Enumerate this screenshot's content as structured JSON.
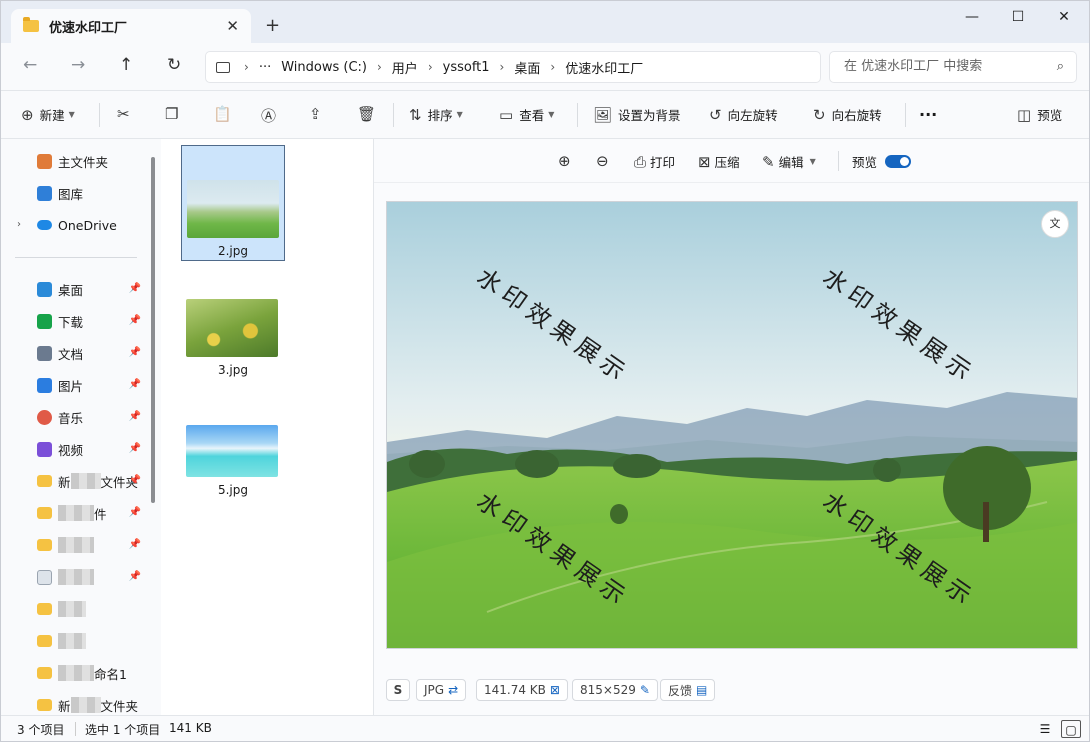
{
  "tab": {
    "title": "优速水印工厂",
    "close": "✕",
    "new": "+"
  },
  "window_controls": {
    "minimize": "—",
    "maximize": "☐",
    "close": "✕"
  },
  "nav": {
    "back": "←",
    "forward": "→",
    "up": "↑",
    "refresh": "↻"
  },
  "address": {
    "more": "···",
    "segments": [
      "Windows (C:)",
      "用户",
      "yssoft1",
      "桌面",
      "优速水印工厂"
    ]
  },
  "search": {
    "placeholder": "在 优速水印工厂 中搜索"
  },
  "toolbar": {
    "new": "新建",
    "sort": "排序",
    "view": "查看",
    "set_background": "设置为背景",
    "rotate_left": "向左旋转",
    "rotate_right": "向右旋转",
    "more": "···",
    "preview": "预览"
  },
  "sidebar": {
    "top": [
      {
        "label": "主文件夹",
        "color": "#e07b39"
      },
      {
        "label": "图库",
        "color": "#2f7fd8"
      },
      {
        "label": "OneDrive",
        "color": "#1e88e5"
      }
    ],
    "quick": [
      {
        "label": "桌面",
        "color": "#2b8ad8"
      },
      {
        "label": "下载",
        "color": "#17a34a"
      },
      {
        "label": "文档",
        "color": "#6b7a8f"
      },
      {
        "label": "图片",
        "color": "#2b7de0"
      },
      {
        "label": "音乐",
        "color": "#e05a47"
      },
      {
        "label": "视频",
        "color": "#7b4fd8"
      }
    ],
    "folders": [
      {
        "prefix": "新",
        "suffix": "文件夹"
      },
      {
        "prefix": "",
        "suffix": "件"
      },
      {
        "prefix": "",
        "suffix": ""
      },
      {
        "prefix": "",
        "suffix": ""
      },
      {
        "prefix": "",
        "suffix": ""
      },
      {
        "prefix": "",
        "suffix": ""
      },
      {
        "prefix": "",
        "suffix": "命名1"
      },
      {
        "prefix": "新",
        "suffix": "文件夹"
      }
    ]
  },
  "files": [
    {
      "name": "2.jpg",
      "selected": true
    },
    {
      "name": "3.jpg",
      "selected": false
    },
    {
      "name": "5.jpg",
      "selected": false
    }
  ],
  "preview_tools": {
    "print": "打印",
    "compress": "压缩",
    "edit": "编辑",
    "preview": "预览",
    "zoom_in": "⊕",
    "zoom_out": "⊖"
  },
  "watermark_text": "水印效果展示",
  "preview_info": {
    "format": "JPG",
    "size": "141.74 KB",
    "dimensions": "815×529",
    "feedback": "反馈"
  },
  "status": {
    "count": "3 个项目",
    "selected": "选中 1 个项目",
    "size": "141 KB"
  }
}
